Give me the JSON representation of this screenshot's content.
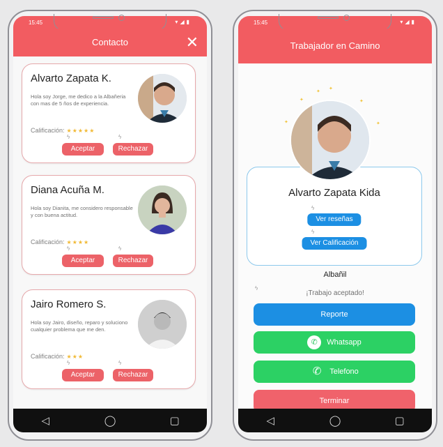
{
  "colors": {
    "primary": "#f25c61",
    "accept_button": "#ec6268",
    "blue_button": "#1c8fe3",
    "green_button": "#2cd164",
    "terminate_button": "#f0626b"
  },
  "statusbar": {
    "time": "15:45"
  },
  "left_screen": {
    "title": "Contacto",
    "close_icon": "close-icon",
    "rating_label": "Calificación:",
    "accept_label": "Aceptar",
    "reject_label": "Rechazar",
    "contacts": [
      {
        "name": "Alvarto Zapata K.",
        "description": "Hola soy Jorge, me dedico a la Albañeria con mas de 5 ños de experiencia.",
        "stars": "★★★★★",
        "rating": 5,
        "photo_icon": "person-photo"
      },
      {
        "name": "Diana Acuña M.",
        "description": "Hola soy Dianita, me considero responsable y con buena actitud.",
        "stars": "★★★★",
        "rating": 4,
        "photo_icon": "person-photo"
      },
      {
        "name": "Jairo Romero S.",
        "description": "Hola soy Jairo, diseño, reparo y soluciono cualquier problema que me den.",
        "stars": "★★★",
        "rating": 3,
        "photo_icon": "person-photo"
      }
    ]
  },
  "right_screen": {
    "title": "Trabajador en Camino",
    "worker_name": "Alvarto Zapata Kida",
    "see_reviews": "Ver reseñas",
    "see_rating": "Ver Calificación",
    "role": "Albañil",
    "status": "¡Trabajo aceptado!",
    "actions": {
      "report": "Reporte",
      "whatsapp": "Whatsapp",
      "phone": "Telefono",
      "finish": "Terminar"
    }
  },
  "navbar": {
    "back_icon": "◁",
    "home_icon": "◯",
    "recent_icon": "▢"
  }
}
